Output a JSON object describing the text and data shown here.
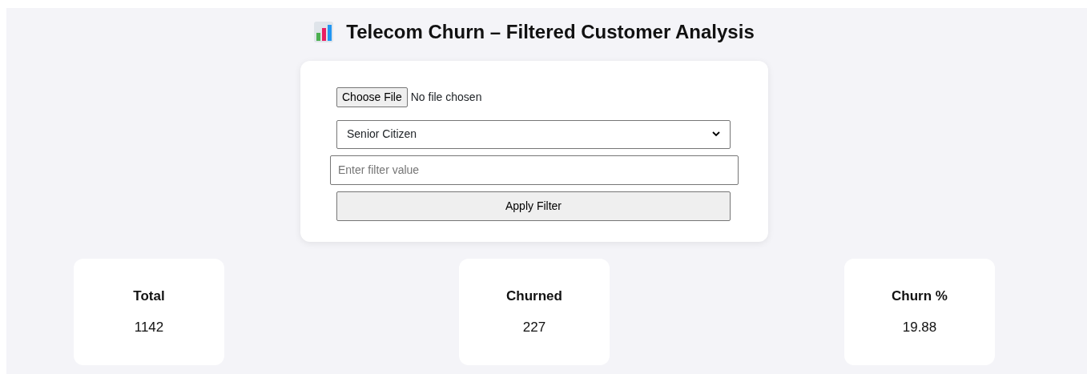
{
  "title": "Telecom Churn – Filtered Customer Analysis",
  "file_input": {
    "button": "Choose File",
    "status": "No file chosen"
  },
  "filter_select": {
    "value": "Senior Citizen"
  },
  "filter_input": {
    "placeholder": "Enter filter value"
  },
  "apply_button": "Apply Filter",
  "stats": [
    {
      "label": "Total",
      "value": "1142"
    },
    {
      "label": "Churned",
      "value": "227"
    },
    {
      "label": "Churn %",
      "value": "19.88"
    }
  ]
}
